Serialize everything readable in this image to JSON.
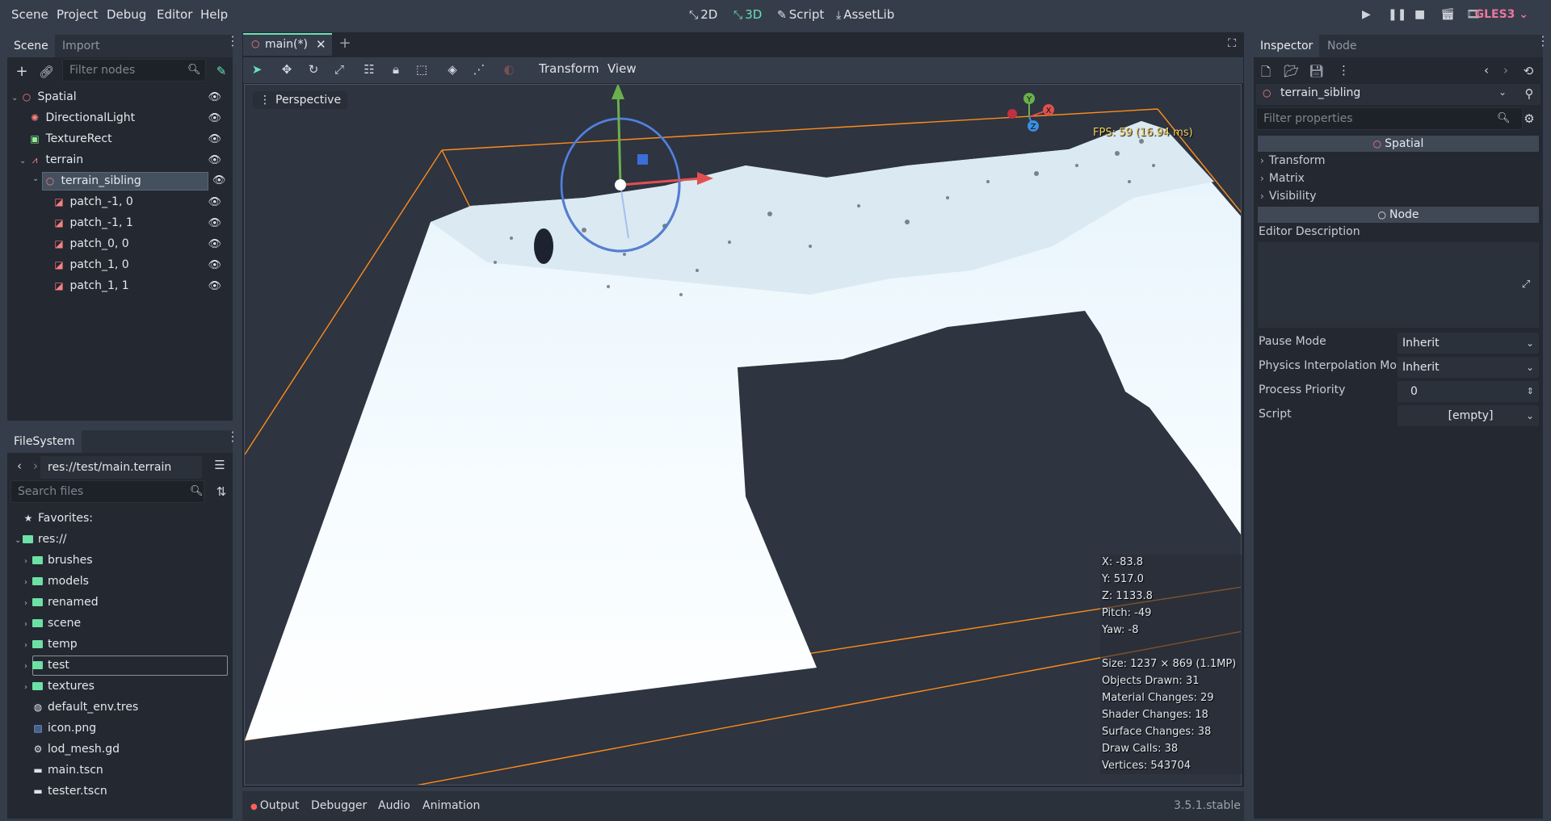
{
  "menubar": {
    "items": [
      "Scene",
      "Project",
      "Debug",
      "Editor",
      "Help"
    ],
    "modes": [
      {
        "label": "2D",
        "icon": "⤡"
      },
      {
        "label": "3D",
        "icon": "⤡"
      },
      {
        "label": "Script",
        "icon": "✎"
      },
      {
        "label": "AssetLib",
        "icon": "⤓"
      }
    ],
    "renderer": "GLES3 ⌄"
  },
  "scene_dock": {
    "tabs": [
      "Scene",
      "Import"
    ],
    "filter_placeholder": "Filter nodes",
    "nodes": [
      {
        "label": "Spatial",
        "icon": "○",
        "color": "#fc7f7f"
      },
      {
        "label": "DirectionalLight",
        "icon": "✺",
        "color": "#fc7f7f"
      },
      {
        "label": "TextureRect",
        "icon": "▣",
        "color": "#8eef97"
      },
      {
        "label": "terrain",
        "icon": "⩘",
        "color": "#fc7f7f"
      },
      {
        "label": "terrain_sibling",
        "icon": "○",
        "color": "#fc7f7f"
      },
      {
        "label": "patch_-1, 0",
        "icon": "◪",
        "color": "#fc7f7f"
      },
      {
        "label": "patch_-1, 1",
        "icon": "◪",
        "color": "#fc7f7f"
      },
      {
        "label": "patch_0, 0",
        "icon": "◪",
        "color": "#fc7f7f"
      },
      {
        "label": "patch_1, 0",
        "icon": "◪",
        "color": "#fc7f7f"
      },
      {
        "label": "patch_1, 1",
        "icon": "◪",
        "color": "#fc7f7f"
      }
    ]
  },
  "filesystem": {
    "tab": "FileSystem",
    "path": "res://test/main.terrain",
    "search_placeholder": "Search files",
    "favorites": "Favorites:",
    "root": "res://",
    "folders": [
      "brushes",
      "models",
      "renamed",
      "scene",
      "temp",
      "test",
      "textures"
    ],
    "files": [
      {
        "label": "default_env.tres",
        "icon": "◍"
      },
      {
        "label": "icon.png",
        "icon": "▨"
      },
      {
        "label": "lod_mesh.gd",
        "icon": "⚙"
      },
      {
        "label": "main.tscn",
        "icon": "▬"
      },
      {
        "label": "tester.tscn",
        "icon": "▬"
      }
    ]
  },
  "editor": {
    "tab_label": "main(*)",
    "toolbar_menus": [
      "Transform",
      "View"
    ],
    "viewport_label": "Perspective",
    "fps": "FPS: 59 (16.94 ms)",
    "stats": [
      "X: -83.8",
      "Y: 517.0",
      "Z: 1133.8",
      "Pitch: -49",
      "Yaw: -8",
      "Size: 1237 × 869 (1.1MP)",
      "Objects Drawn: 31",
      "Material Changes: 29",
      "Shader Changes: 18",
      "Surface Changes: 38",
      "Draw Calls: 38",
      "Vertices: 543704"
    ],
    "gizmo_axes": [
      "Y",
      "X",
      "Z"
    ]
  },
  "bottom_panel": {
    "tabs": [
      "Output",
      "Debugger",
      "Audio",
      "Animation"
    ],
    "version": "3.5.1.stable"
  },
  "inspector": {
    "tabs": [
      "Inspector",
      "Node"
    ],
    "object": "terrain_sibling",
    "filter_placeholder": "Filter properties",
    "sections": [
      "Spatial",
      "Node"
    ],
    "groups": [
      "Transform",
      "Matrix",
      "Visibility"
    ],
    "editor_description": "Editor Description",
    "properties": [
      {
        "label": "Pause Mode",
        "value": "Inherit"
      },
      {
        "label": "Physics Interpolation Mo",
        "value": "Inherit"
      },
      {
        "label": "Process Priority",
        "value": "0"
      },
      {
        "label": "Script",
        "value": "[empty]"
      }
    ]
  },
  "colors": {
    "accent": "#69e0b6",
    "node_red": "#fc7f7f",
    "selection_box": "#ff8c1a"
  }
}
